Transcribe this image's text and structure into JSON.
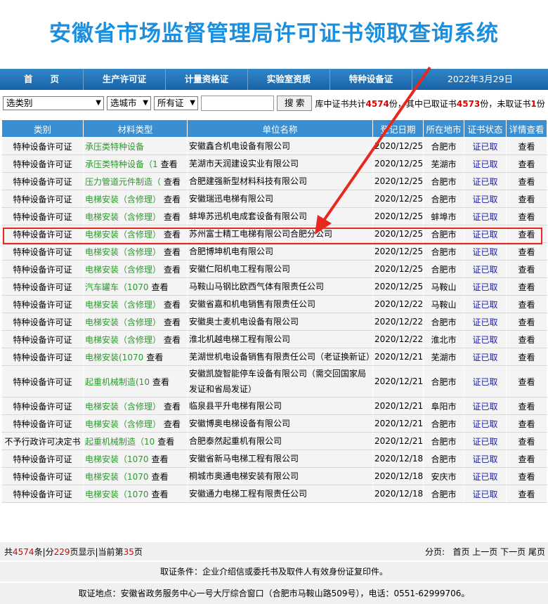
{
  "title": "安徽省市场监督管理局许可证书领取查询系统",
  "nav": {
    "items": [
      "首　　页",
      "生产许可证",
      "计量资格证",
      "实验室资质",
      "特种设备证"
    ],
    "date": "2022年3月29日"
  },
  "filters": {
    "category": "选类别",
    "city": "选城市",
    "cert": "所有证",
    "keyword": "",
    "search_label": "搜 索",
    "stats_prefix": "库中证书共计",
    "total": "4574",
    "stats_mid": "份，其中已取证书",
    "taken": "4573",
    "stats_mid2": "份，未取证书",
    "untaken": "1",
    "stats_suffix": "份"
  },
  "table": {
    "headers": [
      "类别",
      "材料类型",
      "单位名称",
      "登记日期",
      "所在地市",
      "证书状态",
      "详情查看"
    ],
    "rows": [
      {
        "cat": "特种设备许可证",
        "mat": "承压类特种设备",
        "view": "",
        "unit": "安徽鑫合机电设备有限公司",
        "date": "2020/12/25",
        "city": "合肥市",
        "status": "证已取",
        "detail": "查看"
      },
      {
        "cat": "特种设备许可证",
        "mat": "承压类特种设备（1",
        "view": "查看",
        "unit": "芜湖市天润建设实业有限公司",
        "date": "2020/12/25",
        "city": "芜湖市",
        "status": "证已取",
        "detail": "查看"
      },
      {
        "cat": "特种设备许可证",
        "mat": "压力管道元件制造（",
        "view": "查看",
        "unit": "合肥建强新型材料科技有限公司",
        "date": "2020/12/25",
        "city": "合肥市",
        "status": "证已取",
        "detail": "查看"
      },
      {
        "cat": "特种设备许可证",
        "mat": "电梯安装（含修理）",
        "view": "查看",
        "unit": "安徽瑞迅电梯有限公司",
        "date": "2020/12/25",
        "city": "合肥市",
        "status": "证已取",
        "detail": "查看"
      },
      {
        "cat": "特种设备许可证",
        "mat": "电梯安装（含修理）",
        "view": "查看",
        "unit": "蚌埠苏迅机电成套设备有限公司",
        "date": "2020/12/25",
        "city": "蚌埠市",
        "status": "证已取",
        "detail": "查看"
      },
      {
        "cat": "特种设备许可证",
        "mat": "电梯安装（含修理）",
        "view": "查看",
        "unit": "苏州富士精工电梯有限公司合肥分公司",
        "date": "2020/12/25",
        "city": "合肥市",
        "status": "证已取",
        "detail": "查看"
      },
      {
        "cat": "特种设备许可证",
        "mat": "电梯安装（含修理）",
        "view": "查看",
        "unit": "合肥博坤机电有限公司",
        "date": "2020/12/25",
        "city": "合肥市",
        "status": "证已取",
        "detail": "查看"
      },
      {
        "cat": "特种设备许可证",
        "mat": "电梯安装（含修理）",
        "view": "查看",
        "unit": "安徽仁阳机电工程有限公司",
        "date": "2020/12/25",
        "city": "合肥市",
        "status": "证已取",
        "detail": "查看"
      },
      {
        "cat": "特种设备许可证",
        "mat": "汽车罐车（1070",
        "view": "查看",
        "unit": "马鞍山马钢比欧西气体有限责任公司",
        "date": "2020/12/25",
        "city": "马鞍山",
        "status": "证已取",
        "detail": "查看"
      },
      {
        "cat": "特种设备许可证",
        "mat": "电梯安装（含修理）",
        "view": "查看",
        "unit": "安徽省嘉和机电销售有限责任公司",
        "date": "2020/12/22",
        "city": "马鞍山",
        "status": "证已取",
        "detail": "查看"
      },
      {
        "cat": "特种设备许可证",
        "mat": "电梯安装（含修理）",
        "view": "查看",
        "unit": "安徽奥士麦机电设备有限公司",
        "date": "2020/12/22",
        "city": "合肥市",
        "status": "证已取",
        "detail": "查看"
      },
      {
        "cat": "特种设备许可证",
        "mat": "电梯安装（含修理）",
        "view": "查看",
        "unit": "淮北机越电梯工程有限公司",
        "date": "2020/12/22",
        "city": "淮北市",
        "status": "证已取",
        "detail": "查看"
      },
      {
        "cat": "特种设备许可证",
        "mat": "电梯安装(1070",
        "view": "查看",
        "unit": "芜湖世机电设备销售有限责任公司（老证换新证）",
        "date": "2020/12/21",
        "city": "芜湖市",
        "status": "证已取",
        "detail": "查看",
        "tall": true
      },
      {
        "cat": "特种设备许可证",
        "mat": "起重机械制造(10",
        "view": "查看",
        "unit": "安徽凯旋智能停车设备有限公司（需交回国家局发证和省局发证）",
        "date": "2020/12/21",
        "city": "合肥市",
        "status": "证已取",
        "detail": "查看",
        "tall": true
      },
      {
        "cat": "特种设备许可证",
        "mat": "电梯安装（含修理）",
        "view": "查看",
        "unit": "临泉县平升电梯有限公司",
        "date": "2020/12/21",
        "city": "阜阳市",
        "status": "证已取",
        "detail": "查看"
      },
      {
        "cat": "特种设备许可证",
        "mat": "电梯安装（含修理）",
        "view": "查看",
        "unit": "安徽博奥电梯设备有限公司",
        "date": "2020/12/21",
        "city": "合肥市",
        "status": "证已取",
        "detail": "查看"
      },
      {
        "cat": "不予行政许可决定书",
        "mat": "起重机械制造（10",
        "view": "查看",
        "unit": "合肥泰然起重机有限公司",
        "date": "2020/12/21",
        "city": "合肥市",
        "status": "证已取",
        "detail": "查看"
      },
      {
        "cat": "特种设备许可证",
        "mat": "电梯安装（1070",
        "view": "查看",
        "unit": "安徽省新马电梯工程有限公司",
        "date": "2020/12/18",
        "city": "合肥市",
        "status": "证已取",
        "detail": "查看"
      },
      {
        "cat": "特种设备许可证",
        "mat": "电梯安装（1070",
        "view": "查看",
        "unit": "桐城市奥通电梯安装有限公司",
        "date": "2020/12/18",
        "city": "安庆市",
        "status": "证已取",
        "detail": "查看"
      },
      {
        "cat": "特种设备许可证",
        "mat": "电梯安装（1070",
        "view": "查看",
        "unit": "安徽通力电梯工程有限责任公司",
        "date": "2020/12/18",
        "city": "合肥市",
        "status": "证已取",
        "detail": "查看"
      }
    ]
  },
  "pager": {
    "p1": "共",
    "total": "4574",
    "p2": "条|分",
    "pages": "229",
    "p3": "页显示|当前第",
    "current": "35",
    "p4": "页",
    "label": "分页:",
    "first": "首页",
    "prev": "上一页",
    "next": "下一页",
    "last": "尾页"
  },
  "notes": {
    "condition": "取证条件：企业介绍信或委托书及取件人有效身份证复印件。",
    "location": "取证地点：安徽省政务服务中心一号大厅综合窗口（合肥市马鞍山路509号），电话：0551-62999706。"
  },
  "colors": {
    "nav": "#1a63a6",
    "header_cell": "#3b8fd0",
    "highlight": "#e8271f",
    "title": "#1a8fe0"
  }
}
